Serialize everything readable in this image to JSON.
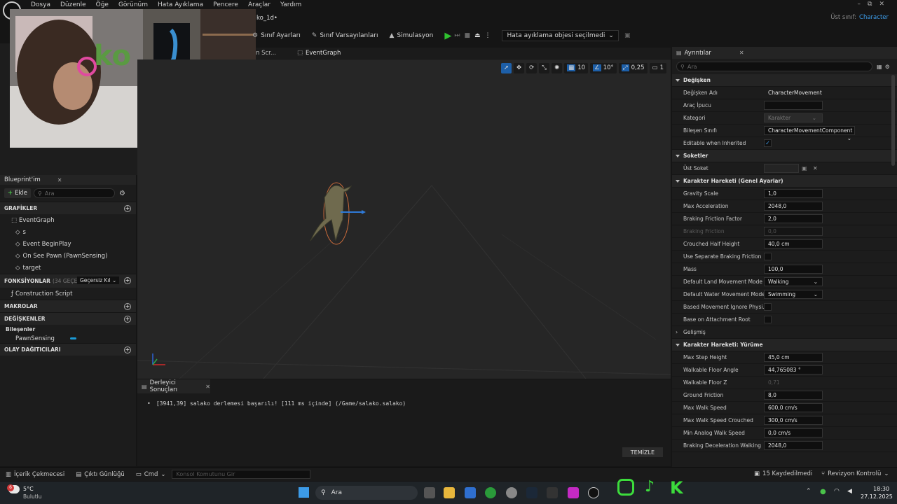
{
  "menu": [
    "Dosya",
    "Düzenle",
    "Öğe",
    "Görünüm",
    "Hata Ayıklama",
    "Pencere",
    "Araçlar",
    "Yardım"
  ],
  "window": {
    "tab_title": "ko_1d•",
    "parent_label": "Üst sınıf:",
    "parent_value": "Character"
  },
  "toolbar": {
    "class_settings": "Sınıf Ayarları",
    "class_defaults": "Sınıf Varsayılanları",
    "simulation": "Simulasyon",
    "debug_select": "Hata ayıklama objesi seçilmedi"
  },
  "tabs": {
    "construction": "n Scr...",
    "eventgraph": "EventGraph"
  },
  "viewport_tools": {
    "grid": "10",
    "angle": "10°",
    "scale": "0,25",
    "cam": "1"
  },
  "blueprint": {
    "title": "Blueprint'im",
    "add": "Ekle",
    "search_placeholder": "Ara",
    "graphs": "GRAFİKLER",
    "graph_items": [
      "EventGraph",
      "s",
      "Event BeginPlay",
      "On See Pawn (PawnSensing)",
      "target"
    ],
    "functions": "FONKSİYONLAR",
    "functions_count": "(34 GEÇERS",
    "override": "Geçersiz Kıl",
    "function_items": [
      "Construction Script"
    ],
    "macros": "MAKROLAR",
    "variables": "DEĞİŞKENLER",
    "components": "Bileşenler",
    "component_items": [
      "PawnSensing"
    ],
    "dispatchers": "OLAY DAĞITICILARI"
  },
  "details": {
    "title": "Ayrıntılar",
    "search_placeholder": "Ara",
    "sec_variable": "Değişken",
    "variable_rows": [
      {
        "label": "Değişken Adı",
        "value": "CharacterMovement"
      },
      {
        "label": "Araç İpucu",
        "value": ""
      },
      {
        "label": "Kategori",
        "value": "Karakter"
      },
      {
        "label": "Bileşen Sınıfı",
        "value": "CharacterMovementComponent"
      },
      {
        "label": "Editable when Inherited",
        "value": "✓"
      }
    ],
    "sec_sockets": "Soketler",
    "socket_label": "Üst Soket",
    "sec_general": "Karakter Hareketi (Genel Ayarlar)",
    "general_rows": [
      {
        "label": "Gravity Scale",
        "value": "1,0"
      },
      {
        "label": "Max Acceleration",
        "value": "2048,0"
      },
      {
        "label": "Braking Friction Factor",
        "value": "2,0"
      },
      {
        "label": "Braking Friction",
        "value": "0,0"
      },
      {
        "label": "Crouched Half Height",
        "value": "40,0 cm"
      },
      {
        "label": "Use Separate Braking Friction",
        "value": ""
      },
      {
        "label": "Mass",
        "value": "100,0"
      },
      {
        "label": "Default Land Movement Mode",
        "value": "Walking"
      },
      {
        "label": "Default Water Movement Mode",
        "value": "Swimming"
      },
      {
        "label": "Based Movement Ignore Physi...",
        "value": ""
      },
      {
        "label": "Base on Attachment Root",
        "value": ""
      }
    ],
    "advanced": "Gelişmiş",
    "sec_walking": "Karakter Hareketi: Yürüme",
    "walking_rows": [
      {
        "label": "Max Step Height",
        "value": "45,0 cm"
      },
      {
        "label": "Walkable Floor Angle",
        "value": "44,765083 °"
      },
      {
        "label": "Walkable Floor Z",
        "value": "0,71"
      },
      {
        "label": "Ground Friction",
        "value": "8,0"
      },
      {
        "label": "Max Walk Speed",
        "value": "600,0 cm/s"
      },
      {
        "label": "Max Walk Speed Crouched",
        "value": "300,0 cm/s"
      },
      {
        "label": "Min Analog Walk Speed",
        "value": "0,0 cm/s"
      },
      {
        "label": "Braking Deceleration Walking",
        "value": "2048,0"
      }
    ]
  },
  "compiler": {
    "title": "Derleyici Sonuçları",
    "message": "[3941,39] salako derlemesi başarılı! [111 ms içinde] (/Game/salako.salako)",
    "clear": "TEMİZLE"
  },
  "statusbar": {
    "content_drawer": "İçerik Çekmecesi",
    "output_log": "Çıktı Günlüğü",
    "cmd": "Cmd",
    "console_placeholder": "Konsol Komutunu Gir",
    "saved": "15 Kaydedilmedi",
    "revision": "Revizyon Kontrolü"
  },
  "taskbar": {
    "weather_temp": "5°C",
    "weather_desc": "Bulutlu",
    "weather_badge": "6",
    "search": "Ara",
    "time": "18:30",
    "date": "27.12.2025"
  },
  "colors": {
    "accent": "#1d5fa8",
    "play": "#2fc12f",
    "component_tag": "#1a9ad6"
  }
}
